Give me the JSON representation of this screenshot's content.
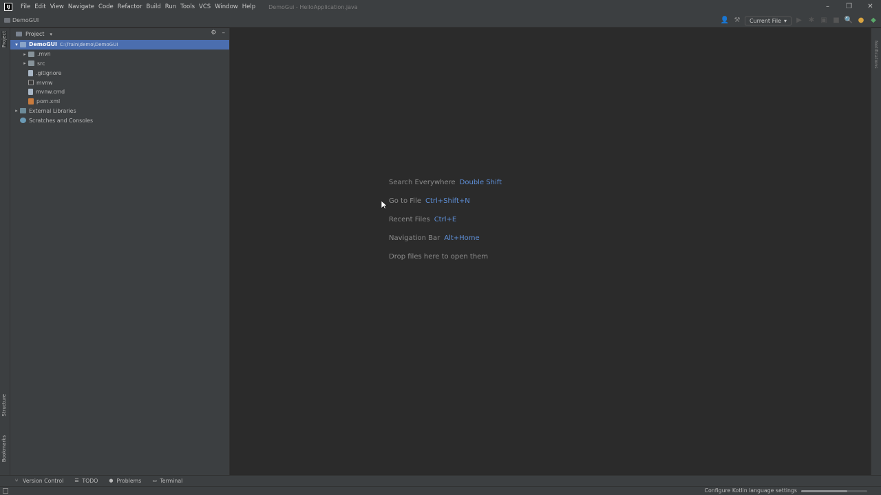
{
  "app": {
    "logo_text": "IJ",
    "window_title": "DemoGui - HelloApplication.java"
  },
  "menu": [
    "File",
    "Edit",
    "View",
    "Navigate",
    "Code",
    "Refactor",
    "Build",
    "Run",
    "Tools",
    "VCS",
    "Window",
    "Help"
  ],
  "navbar": {
    "breadcrumb": "DemoGUI",
    "run_config": "Current File"
  },
  "left_tabs": {
    "project": "Project",
    "structure": "Structure",
    "bookmarks": "Bookmarks"
  },
  "right_tabs": {
    "notifications": "Notifications"
  },
  "project_panel": {
    "title": "Project",
    "tree": [
      {
        "label": "DemoGUI",
        "path": "C:\\Train\\demo\\DemoGUI",
        "icon": "module-icon",
        "expanded": true,
        "selected": true,
        "level": 0,
        "arrow": "▾"
      },
      {
        "label": ".mvn",
        "icon": "folder-icon",
        "level": 1,
        "arrow": "▸"
      },
      {
        "label": "src",
        "icon": "folder-icon",
        "level": 1,
        "arrow": "▸"
      },
      {
        "label": ".gitignore",
        "icon": "file-icon",
        "level": 1,
        "arrow": ""
      },
      {
        "label": "mvnw",
        "icon": "terminal-file-icon",
        "level": 1,
        "arrow": ""
      },
      {
        "label": "mvnw.cmd",
        "icon": "file-icon",
        "level": 1,
        "arrow": ""
      },
      {
        "label": "pom.xml",
        "icon": "maven-icon",
        "level": 1,
        "arrow": ""
      },
      {
        "label": "External Libraries",
        "icon": "library-icon",
        "level": 0,
        "arrow": "▸"
      },
      {
        "label": "Scratches and Consoles",
        "icon": "scratch-icon",
        "level": 0,
        "arrow": ""
      }
    ]
  },
  "editor_hints": [
    {
      "label": "Search Everywhere",
      "shortcut": "Double Shift"
    },
    {
      "label": "Go to File",
      "shortcut": "Ctrl+Shift+N"
    },
    {
      "label": "Recent Files",
      "shortcut": "Ctrl+E"
    },
    {
      "label": "Navigation Bar",
      "shortcut": "Alt+Home"
    },
    {
      "label": "Drop files here to open them",
      "shortcut": ""
    }
  ],
  "bottom_tools": [
    "Version Control",
    "TODO",
    "Problems",
    "Terminal"
  ],
  "status": {
    "message": "Configure Kotlin language settings",
    "progress": 0.7
  },
  "colors": {
    "accent_selection": "#4b6eaf",
    "shortcut_blue": "#5e8fd7",
    "editor_bg": "#2b2b2b",
    "panel_bg": "#3c3f41"
  }
}
